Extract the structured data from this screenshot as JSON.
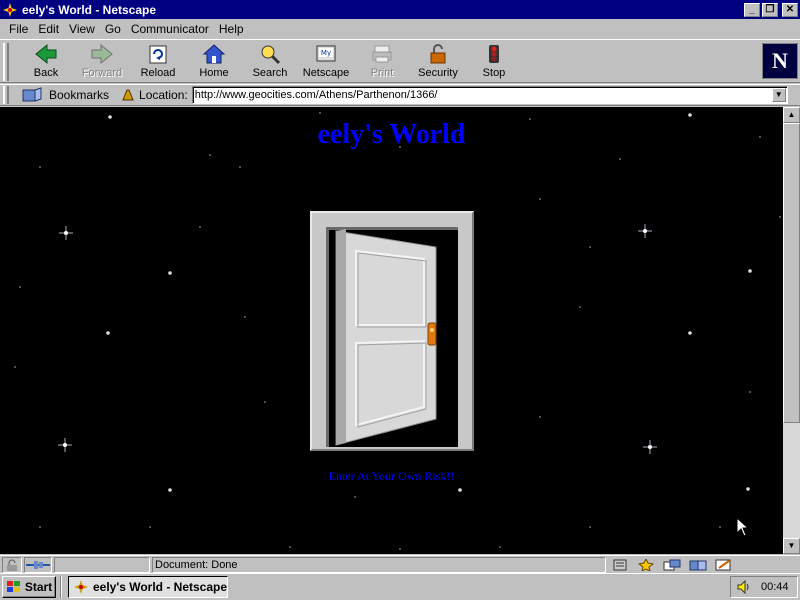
{
  "window": {
    "title": "eely's World - Netscape"
  },
  "menu": [
    {
      "label": "File"
    },
    {
      "label": "Edit"
    },
    {
      "label": "View"
    },
    {
      "label": "Go"
    },
    {
      "label": "Communicator"
    },
    {
      "label": "Help"
    }
  ],
  "toolbar": {
    "back": "Back",
    "forward": "Forward",
    "reload": "Reload",
    "home": "Home",
    "search": "Search",
    "netscape": "Netscape",
    "print": "Print",
    "security": "Security",
    "stop": "Stop"
  },
  "location": {
    "bookmarks": "Bookmarks",
    "label": "Location:",
    "url": "http://www.geocities.com/Athens/Parthenon/1366/"
  },
  "page": {
    "heading": "eely's World",
    "enter_text": "Enter At Your Own Risk!!"
  },
  "status": {
    "text": "Document: Done"
  },
  "taskbar": {
    "start": "Start",
    "task": "eely's World - Netscape",
    "clock": "00:44"
  },
  "colors": {
    "titlebar": "#000080",
    "chrome": "#c0c0c0",
    "page_bg": "#000000",
    "link_blue": "#0000ff"
  }
}
